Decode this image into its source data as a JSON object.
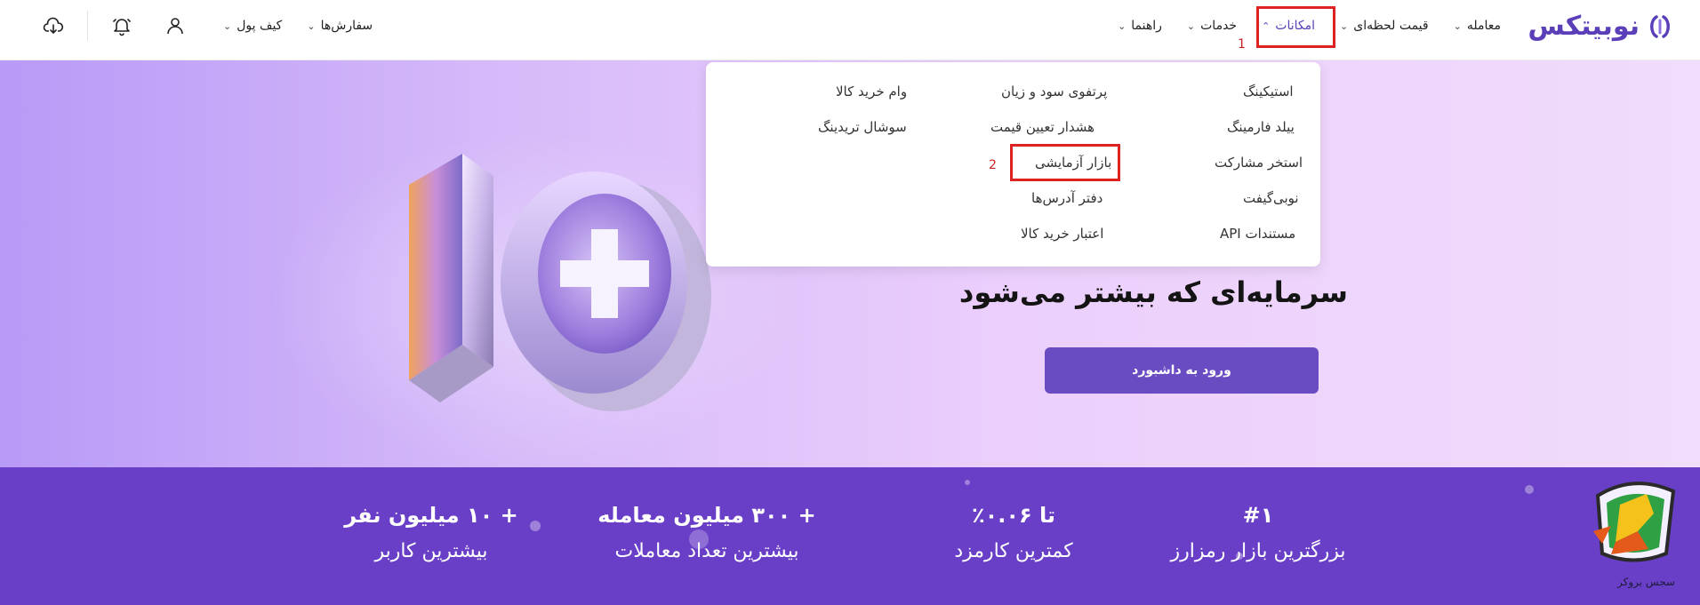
{
  "brand": {
    "logo_text": "نوبیتکس",
    "accent": "#5a3fb8"
  },
  "nav": {
    "items": [
      {
        "label": "معامله",
        "active": false
      },
      {
        "label": "قیمت لحظه‌ای",
        "active": false
      },
      {
        "label": "امکانات",
        "active": true
      },
      {
        "label": "خدمات",
        "active": false
      },
      {
        "label": "راهنما",
        "active": false
      }
    ]
  },
  "left_menus": [
    {
      "label": "کیف پول"
    },
    {
      "label": "سفارش‌ها"
    }
  ],
  "icons": {
    "download": "download-icon",
    "bell": "bell-icon",
    "user": "user-icon"
  },
  "annotations": {
    "one": "1",
    "two": "2"
  },
  "dropdown": {
    "col1": [
      "استیکینگ",
      "ییلد فارمینگ",
      "استخر مشارکت",
      "نوبی‌گیفت",
      "مستندات API"
    ],
    "col2": [
      "پرتفوی سود و زیان",
      "هشدار تعیین قیمت",
      "بازار آزمایشی",
      "دفتر آدرس‌ها",
      "اعتبار خرید کالا"
    ],
    "col3": [
      "وام خرید کالا",
      "سوشال تریدینگ"
    ]
  },
  "hero": {
    "title": "سرمایه‌ای که بیشتر می‌شود",
    "cta_label": "ورود به داشبورد",
    "art_text": "10+"
  },
  "stats": [
    {
      "big": "#۱",
      "small": "بزرگترین بازار رمزارز"
    },
    {
      "big": "تا ۰.۰۶٪",
      "small": "کمترین کارمزد"
    },
    {
      "big": "+ ۳۰۰ میلیون معامله",
      "small": "بیشترین تعداد معاملات"
    },
    {
      "big": "+ ۱۰ میلیون نفر",
      "small": "بیشترین کاربر"
    }
  ],
  "badge": {
    "text": "سجس بروکر"
  },
  "colors": {
    "hero_start": "#b89af7",
    "hero_end": "#f0dcfb",
    "stats_bg": "#6a3fc7",
    "cta": "#6a4cc2",
    "highlight": "#dd2222"
  }
}
